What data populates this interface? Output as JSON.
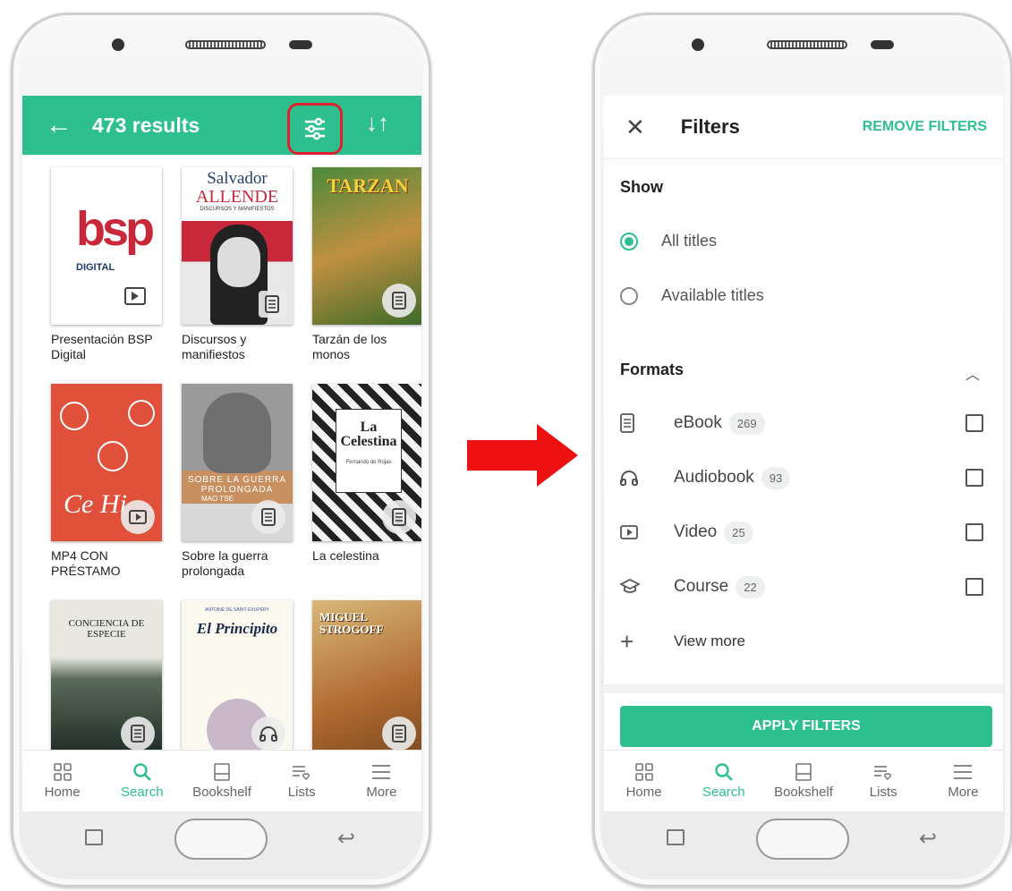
{
  "left_app": {
    "results_label": "473 results",
    "books": [
      {
        "title": "Presentación BSP Digital",
        "cover_text": "bsp",
        "cover_sub": "DIGITAL",
        "format_icon": "video-icon"
      },
      {
        "title": "Discursos y manifiestos",
        "cover_text": "Salvador",
        "cover_sub": "ALLENDE",
        "cover_sub2": "DISCURSOS Y MANIFIESTOS",
        "format_icon": "ebook-icon"
      },
      {
        "title": "Tarzán de los monos",
        "cover_text": "TARZAN",
        "format_icon": "ebook-icon"
      },
      {
        "title": "MP4 CON PRÉSTAMO",
        "cover_text": "Ce Hi",
        "format_icon": "video-icon"
      },
      {
        "title": "Sobre la guerra prolongada",
        "cover_text": "SOBRE LA GUERRA PROLONGADA",
        "cover_sub": "MAO TSE",
        "format_icon": "ebook-icon"
      },
      {
        "title": "La celestina",
        "cover_text": "La Celestina",
        "cover_sub": "Fernando de Rojas",
        "format_icon": "ebook-icon"
      },
      {
        "title": "",
        "cover_text": "CONCIENCIA DE ESPECIE",
        "format_icon": "ebook-icon"
      },
      {
        "title": "",
        "cover_text": "El Principito",
        "cover_sub": "ANTOINE DE SAINT-EXUPÉRY",
        "format_icon": "audiobook-icon"
      },
      {
        "title": "",
        "cover_text": "MIGUEL STROGOFF",
        "format_icon": "ebook-icon"
      }
    ]
  },
  "nav": {
    "tabs": [
      {
        "label": "Home",
        "icon": "grid-icon"
      },
      {
        "label": "Search",
        "icon": "search-icon"
      },
      {
        "label": "Bookshelf",
        "icon": "bookshelf-icon"
      },
      {
        "label": "Lists",
        "icon": "lists-icon"
      },
      {
        "label": "More",
        "icon": "menu-icon"
      }
    ],
    "active": "Search"
  },
  "right_app": {
    "title": "Filters",
    "remove_label": "REMOVE FILTERS",
    "show_label": "Show",
    "show_options": [
      {
        "label": "All titles",
        "selected": true
      },
      {
        "label": "Available titles",
        "selected": false
      }
    ],
    "formats_label": "Formats",
    "formats": [
      {
        "label": "eBook",
        "count": "269",
        "icon": "ebook-icon"
      },
      {
        "label": "Audiobook",
        "count": "93",
        "icon": "headphones-icon"
      },
      {
        "label": "Video",
        "count": "25",
        "icon": "video-icon"
      },
      {
        "label": "Course",
        "count": "22",
        "icon": "graduation-cap-icon"
      }
    ],
    "view_more_label": "View more",
    "apply_label": "APPLY FILTERS"
  },
  "colors": {
    "accent": "#2dc08e",
    "highlight": "#e02030",
    "arrow": "#ee1111"
  }
}
